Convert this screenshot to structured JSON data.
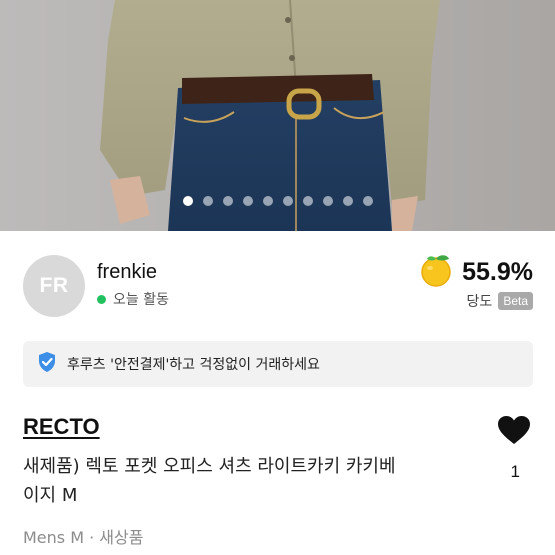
{
  "carousel": {
    "slide_count": 10,
    "active_index": 0
  },
  "seller": {
    "avatar_initials": "FR",
    "name": "frenkie",
    "activity_status": "오늘 활동",
    "status_color": "#22c15e",
    "score_icon": "citrus-fruit-icon",
    "score": "55.9%",
    "score_label": "당도",
    "beta_badge": "Beta"
  },
  "safe_payment": {
    "icon": "shield-check-icon",
    "message": "후루츠 '안전결제'하고 걱정없이 거래하세요",
    "accent_color": "#3d8ee6"
  },
  "product": {
    "brand": "RECTO",
    "title_line1": "새제품) 렉토 포켓 오피스 셔츠 라이트카키 카키베",
    "title_line2": "이지 M",
    "like_icon": "heart-icon",
    "like_count": "1",
    "meta": "Mens M · 새상품"
  }
}
